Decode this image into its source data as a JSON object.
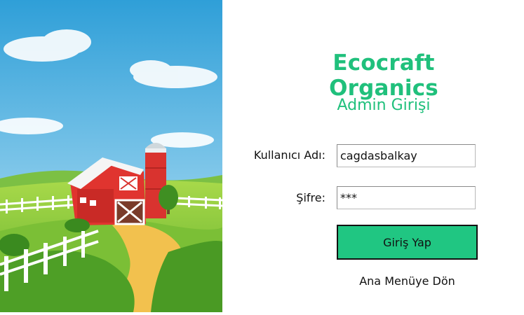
{
  "brand": {
    "title": "Ecocraft Organics",
    "subtitle": "Admin Girişi"
  },
  "form": {
    "username_label": "Kullanıcı Adı:",
    "username_value": "cagdasbalkay",
    "password_label": "Şifre:",
    "password_value": "***",
    "login_button": "Giriş Yap",
    "back_link": "Ana Menüye Dön"
  },
  "colors": {
    "accent": "#20c07c",
    "button": "#20c682"
  }
}
